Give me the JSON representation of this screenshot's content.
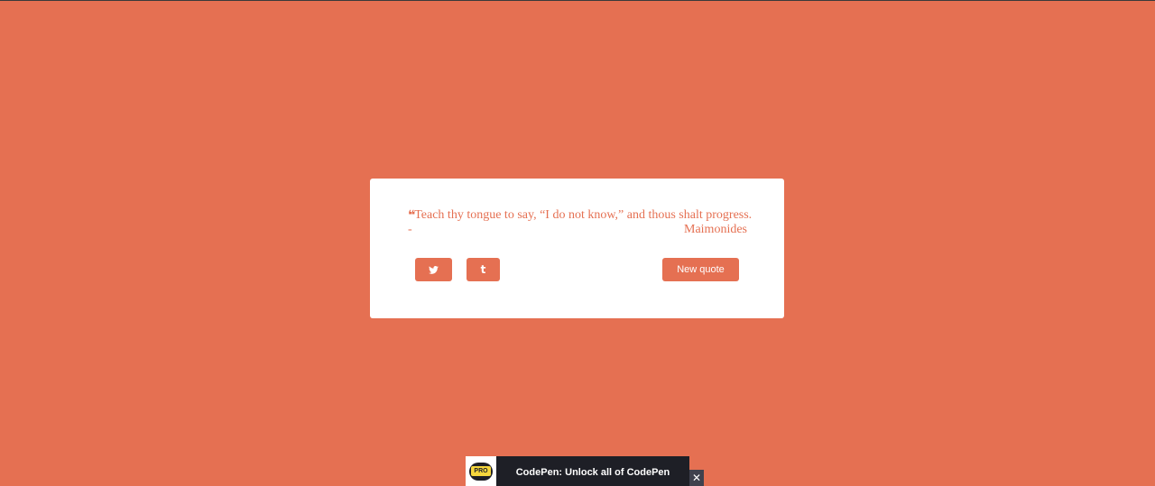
{
  "theme": {
    "accent": "#e57052",
    "card_background": "#ffffff",
    "banner_background": "#1e1f26",
    "pro_badge_color": "#f5d63d"
  },
  "quote": {
    "icon": "quote-left-icon",
    "icon_glyph": "❝",
    "text": "Teach thy tongue to say, “I do not know,” and thous shalt progress.",
    "author_prefix": "-",
    "author": "Maimonides"
  },
  "actions": {
    "twitter_icon": "twitter-icon",
    "tumblr_icon": "tumblr-icon",
    "tumblr_glyph": "t",
    "new_quote_label": "New quote"
  },
  "codepen_banner": {
    "badge_label": "PRO",
    "text": "CodePen: Unlock all of CodePen",
    "close_glyph": "✕"
  }
}
